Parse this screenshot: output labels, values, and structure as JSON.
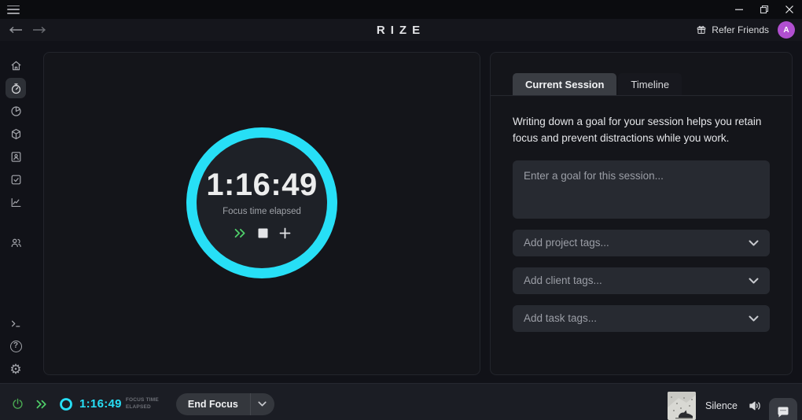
{
  "header": {
    "logo": "RIZE",
    "refer_friends_label": "Refer Friends",
    "avatar_initial": "A"
  },
  "sidebar": {
    "active_item": "timer",
    "items": [
      "home",
      "timer",
      "pie-chart",
      "package",
      "contact-card",
      "tasks",
      "line-chart",
      "team"
    ],
    "footer_items": [
      "terminal",
      "help",
      "settings"
    ]
  },
  "timer": {
    "elapsed": "1:16:49",
    "caption": "Focus time elapsed"
  },
  "session_panel": {
    "tabs": [
      {
        "label": "Current Session",
        "active": true
      },
      {
        "label": "Timeline",
        "active": false
      }
    ],
    "description": "Writing down a goal for your session helps you retain focus and prevent distractions while you work.",
    "goal_placeholder": "Enter a goal for this session...",
    "dropdowns": [
      {
        "label": "Add project tags..."
      },
      {
        "label": "Add client tags..."
      },
      {
        "label": "Add task tags..."
      }
    ]
  },
  "footer": {
    "elapsed": "1:16:49",
    "elapsed_label_line1": "FOCUS TIME",
    "elapsed_label_line2": "ELAPSED",
    "end_focus_label": "End Focus",
    "now_playing": "Silence"
  },
  "colors": {
    "accent_cyan": "#27dff6",
    "accent_green": "#4fd06a",
    "avatar_purple": "#b14fd0"
  }
}
